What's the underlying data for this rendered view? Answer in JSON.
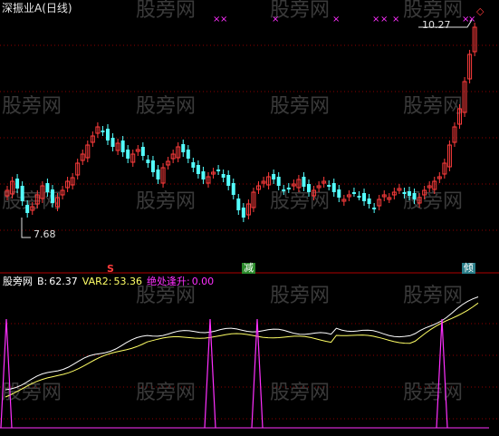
{
  "header": {
    "title": "深振业A(日线)"
  },
  "price_labels": {
    "high": "10.27",
    "low": "7.68"
  },
  "signals": {
    "s_label": "S",
    "jian_label": "减",
    "ting_label": "倾",
    "marker_glyph": "×",
    "diamond_glyph": "◇"
  },
  "indicator": {
    "name": "股旁网",
    "b_label": "B:",
    "b_value": "62.37",
    "var2_label": "VAR2:",
    "var2_value": "53.36",
    "signal_label": "绝处逢升:",
    "signal_value": "0.00"
  },
  "watermark": "股旁网",
  "colors": {
    "up": "#ff3c3c",
    "down": "#54ffff",
    "grid": "#8b0000",
    "magenta": "#ff30ff",
    "white": "#ffffff",
    "yellow": "#ffff66",
    "divider": "#b00000"
  }
}
